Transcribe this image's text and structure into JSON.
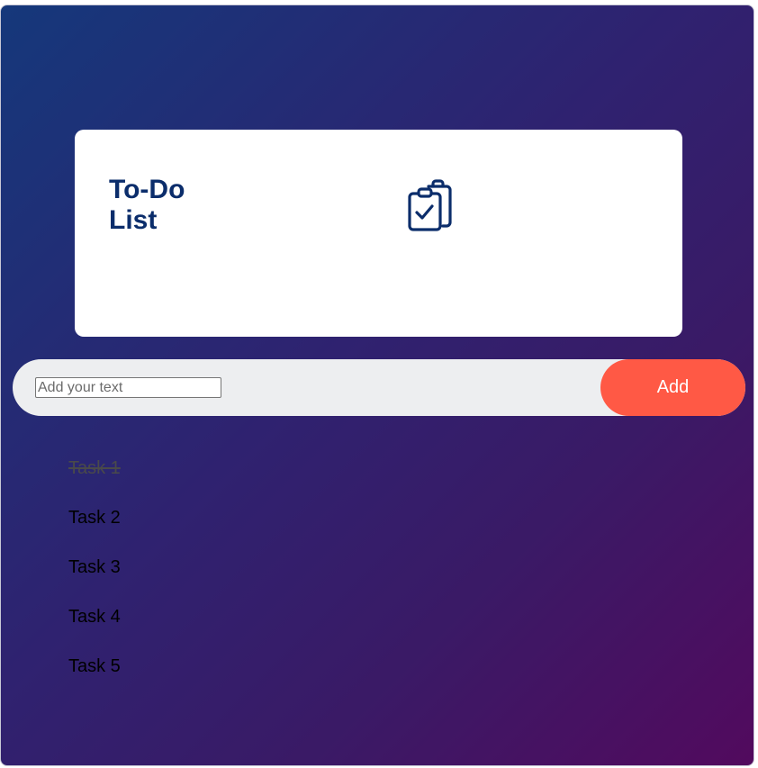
{
  "card": {
    "title": "To-Do List",
    "icon": "clipboard-check-icon"
  },
  "input": {
    "placeholder": "Add your text",
    "value": ""
  },
  "add_button": {
    "label": "Add"
  },
  "tasks": [
    {
      "label": "Task 1",
      "done": true
    },
    {
      "label": "Task 2",
      "done": false
    },
    {
      "label": "Task 3",
      "done": false
    },
    {
      "label": "Task 4",
      "done": false
    },
    {
      "label": "Task 5",
      "done": false
    }
  ],
  "colors": {
    "accent": "#ff5945",
    "title": "#0b2d6b",
    "gradient_start": "#15387b",
    "gradient_end": "#520a5e"
  }
}
